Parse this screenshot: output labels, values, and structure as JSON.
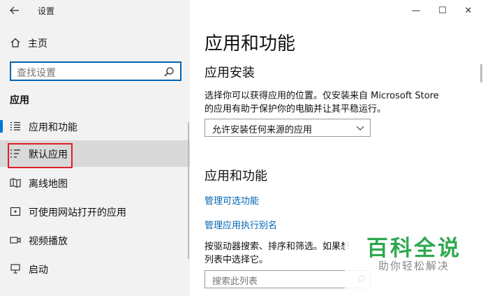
{
  "window": {
    "title": "设置",
    "controls": {
      "minimize": "—",
      "maximize": "☐",
      "close": "✕"
    }
  },
  "sidebar": {
    "home_label": "主页",
    "search_placeholder": "查找设置",
    "section_label": "应用",
    "items": [
      {
        "label": "应用和功能",
        "icon": "apps-features-icon",
        "active": true
      },
      {
        "label": "默认应用",
        "icon": "default-apps-icon",
        "hovered": true
      },
      {
        "label": "离线地图",
        "icon": "offline-maps-icon"
      },
      {
        "label": "可使用网站打开的应用",
        "icon": "apps-for-websites-icon"
      },
      {
        "label": "视频播放",
        "icon": "video-playback-icon"
      },
      {
        "label": "启动",
        "icon": "startup-icon"
      }
    ]
  },
  "main": {
    "title": "应用和功能",
    "install_section": {
      "heading": "应用安装",
      "description": "选择你可以获得应用的位置。仅安装来自 Microsoft Store 的应用有助于保护你的电脑并让其平稳运行。",
      "dropdown_value": "允许安装任何来源的应用"
    },
    "features_section": {
      "heading": "应用和功能",
      "link_optional": "管理可选功能",
      "link_aliases": "管理应用执行别名",
      "description": "按驱动器搜索、排序和筛选。如果想列表中选择它。",
      "search_placeholder": "搜索此列表"
    }
  },
  "watermark": {
    "title": "百科全说",
    "subtitle": "助你轻松解决"
  },
  "colors": {
    "accent": "#0078d7",
    "link": "#0063b1",
    "highlight": "#e02020",
    "watermark_green": "#2ea84f"
  }
}
